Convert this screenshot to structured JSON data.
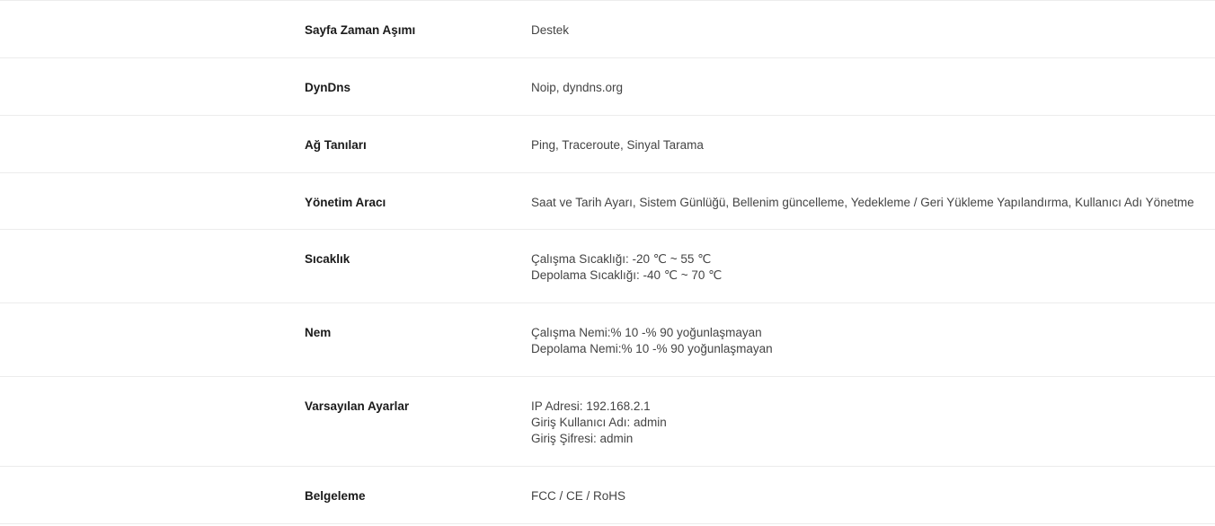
{
  "specs": [
    {
      "label": "Sayfa Zaman Aşımı",
      "lines": [
        "Destek"
      ]
    },
    {
      "label": "DynDns",
      "lines": [
        "Noip, dyndns.org"
      ]
    },
    {
      "label": "Ağ Tanıları",
      "lines": [
        "Ping, Traceroute, Sinyal Tarama"
      ]
    },
    {
      "label": "Yönetim Aracı",
      "lines": [
        "Saat ve Tarih Ayarı, Sistem Günlüğü, Bellenim güncelleme, Yedekleme / Geri Yükleme Yapılandırma, Kullanıcı Adı Yönetme"
      ]
    },
    {
      "label": "Sıcaklık",
      "lines": [
        "Çalışma Sıcaklığı: -20 ℃ ~ 55 ℃",
        "Depolama Sıcaklığı: -40 ℃ ~ 70 ℃"
      ]
    },
    {
      "label": "Nem",
      "lines": [
        "Çalışma Nemi:% 10 -% 90 yoğunlaşmayan",
        "Depolama Nemi:% 10 -% 90 yoğunlaşmayan"
      ]
    },
    {
      "label": "Varsayılan Ayarlar",
      "lines": [
        "IP Adresi: 192.168.2.1",
        "Giriş Kullanıcı Adı: admin",
        "Giriş Şifresi: admin"
      ]
    },
    {
      "label": "Belgeleme",
      "lines": [
        "FCC / CE / RoHS"
      ]
    }
  ]
}
